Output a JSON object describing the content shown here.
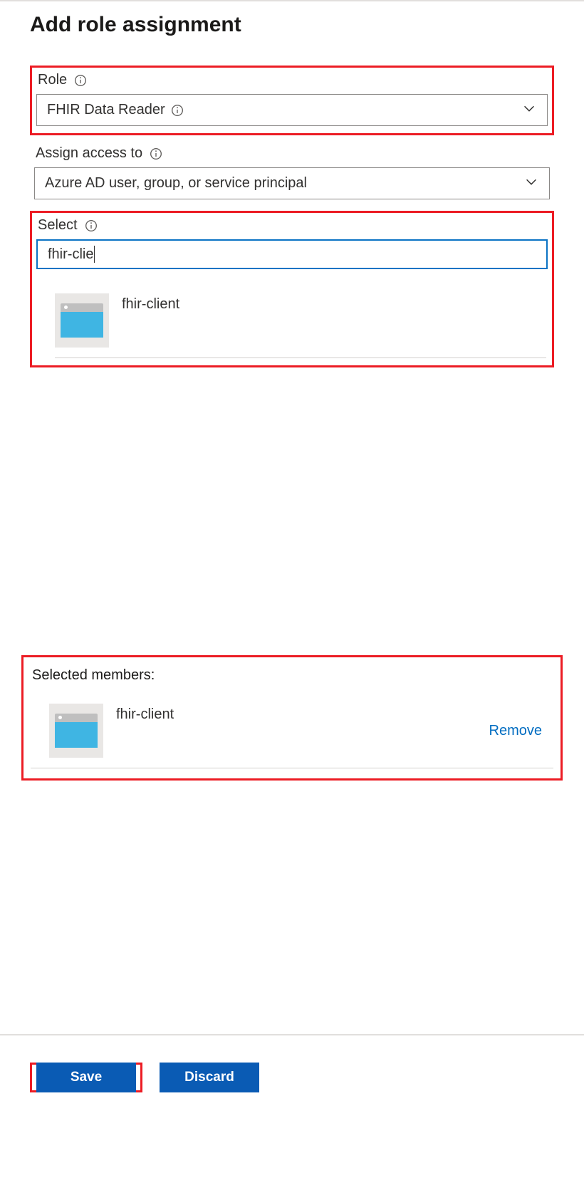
{
  "header": {
    "title": "Add role assignment"
  },
  "form": {
    "role": {
      "label": "Role",
      "value": "FHIR Data Reader"
    },
    "assign_access": {
      "label": "Assign access to",
      "value": "Azure AD user, group, or service principal"
    },
    "select": {
      "label": "Select",
      "value": "fhir-clie",
      "results": [
        {
          "name": "fhir-client"
        }
      ]
    }
  },
  "selected_members": {
    "title": "Selected members:",
    "items": [
      {
        "name": "fhir-client"
      }
    ],
    "remove_label": "Remove"
  },
  "footer": {
    "save": "Save",
    "discard": "Discard"
  },
  "colors": {
    "highlight": "#ec1c24",
    "primary_button": "#0a5bb4",
    "link": "#006cc1",
    "input_focus": "#0a73c4"
  }
}
